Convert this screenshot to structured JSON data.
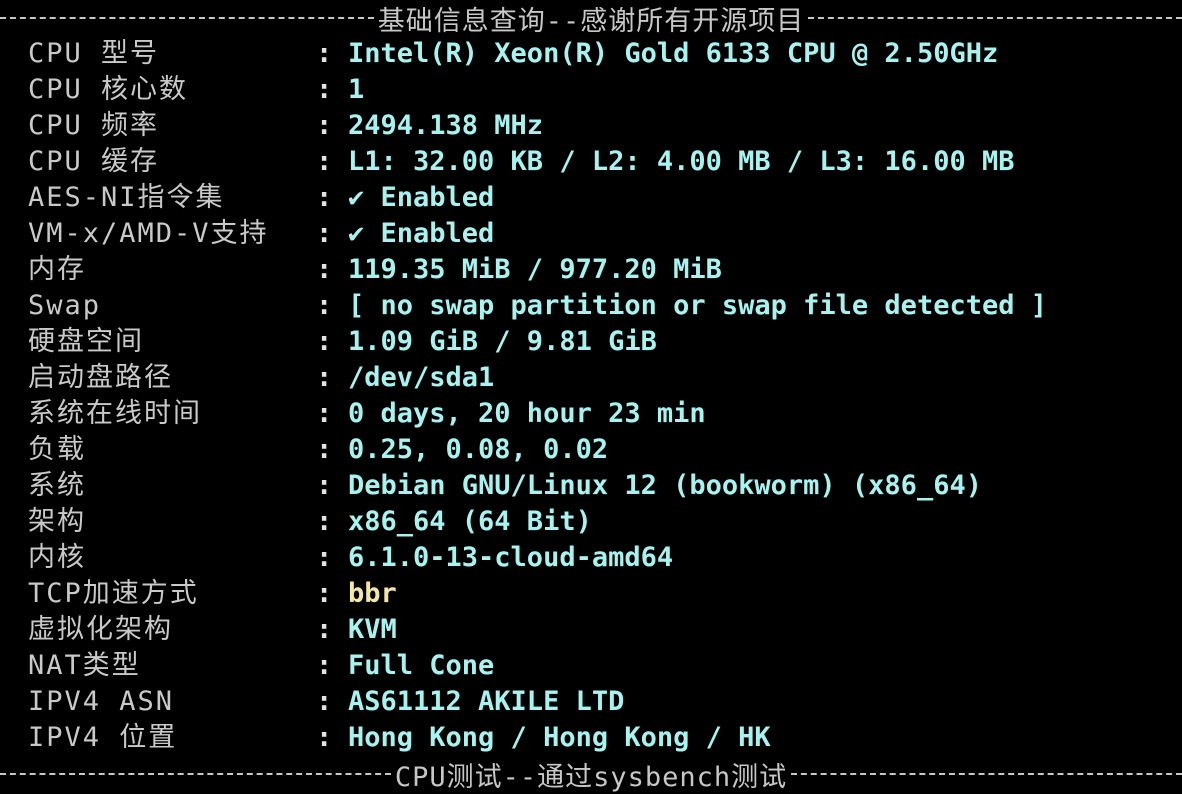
{
  "colors": {
    "background": "#000000",
    "label": "#c9c9c9",
    "value": "#a8f3f0",
    "value_highlight": "#f2e6a8",
    "separator": "#c7c7c7"
  },
  "header": {
    "title": "基础信息查询--感谢所有开源项目"
  },
  "footer": {
    "title": "CPU测试--通过sysbench测试"
  },
  "rows": [
    {
      "label": "CPU 型号",
      "colon": ":",
      "value": "Intel(R) Xeon(R) Gold 6133 CPU @ 2.50GHz"
    },
    {
      "label": "CPU 核心数",
      "colon": ":",
      "value": "1"
    },
    {
      "label": "CPU 频率",
      "colon": ":",
      "value": "2494.138 MHz"
    },
    {
      "label": "CPU 缓存",
      "colon": ":",
      "value": "L1: 32.00 KB / L2: 4.00 MB / L3: 16.00 MB"
    },
    {
      "label": "AES-NI指令集",
      "colon": ":",
      "value": "✔ Enabled"
    },
    {
      "label": "VM-x/AMD-V支持",
      "colon": ":",
      "value": "✔ Enabled"
    },
    {
      "label": "内存",
      "colon": ":",
      "value": "119.35 MiB / 977.20 MiB"
    },
    {
      "label": "Swap",
      "colon": ":",
      "value": "[ no swap partition or swap file detected ]"
    },
    {
      "label": "硬盘空间",
      "colon": ":",
      "value": "1.09 GiB / 9.81 GiB"
    },
    {
      "label": "启动盘路径",
      "colon": ":",
      "value": "/dev/sda1"
    },
    {
      "label": "系统在线时间",
      "colon": ":",
      "value": "0 days, 20 hour 23 min"
    },
    {
      "label": "负载",
      "colon": ":",
      "value": "0.25, 0.08, 0.02"
    },
    {
      "label": "系统",
      "colon": ":",
      "value": "Debian GNU/Linux 12 (bookworm) (x86_64)"
    },
    {
      "label": "架构",
      "colon": ":",
      "value": "x86_64 (64 Bit)"
    },
    {
      "label": "内核",
      "colon": ":",
      "value": "6.1.0-13-cloud-amd64"
    },
    {
      "label": "TCP加速方式",
      "colon": ":",
      "value": "bbr"
    },
    {
      "label": "虚拟化架构",
      "colon": ":",
      "value": "KVM"
    },
    {
      "label": "NAT类型",
      "colon": ":",
      "value": "Full Cone"
    },
    {
      "label": "IPV4 ASN",
      "colon": ":",
      "value": "AS61112 AKILE LTD"
    },
    {
      "label": "IPV4 位置",
      "colon": ":",
      "value": "Hong Kong / Hong Kong / HK"
    }
  ]
}
